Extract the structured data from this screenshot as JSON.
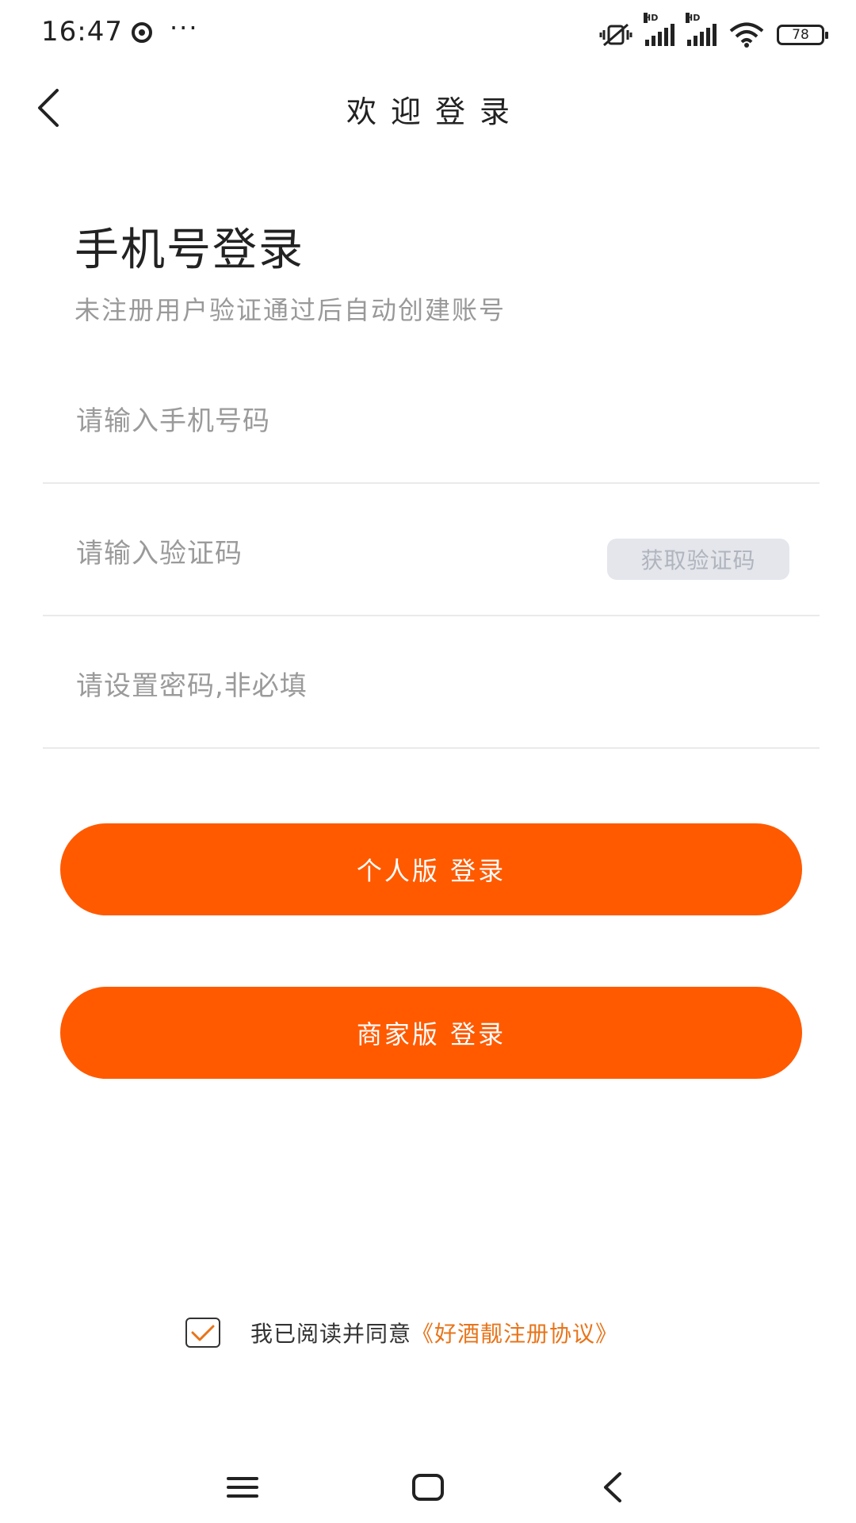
{
  "status_bar": {
    "time": "16:47",
    "more": "···",
    "signal_label_1": "HD",
    "signal_label_2": "HD",
    "battery": "78",
    "icons": [
      "vibrate-icon",
      "signal-icon",
      "signal-icon",
      "wifi-icon",
      "battery-icon"
    ]
  },
  "nav": {
    "title": "欢迎登录",
    "back_icon": "back-arrow-icon"
  },
  "header": {
    "title": "手机号登录",
    "subtitle": "未注册用户验证通过后自动创建账号"
  },
  "form": {
    "phone_placeholder": "请输入手机号码",
    "phone_value": "",
    "code_placeholder": "请输入验证码",
    "code_value": "",
    "get_code_label": "获取验证码",
    "password_placeholder": "请设置密码,非必填",
    "password_value": ""
  },
  "buttons": {
    "personal_login": "个人版 登录",
    "merchant_login": "商家版 登录"
  },
  "agreement": {
    "checked": true,
    "text": "我已阅读并同意",
    "link": "《好酒靓注册协议》"
  },
  "colors": {
    "accent": "#ff5a00",
    "link": "#e8741a",
    "placeholder": "#9a9a9a"
  },
  "system_nav": {
    "icons": [
      "menu-icon",
      "home-icon",
      "back-icon"
    ]
  }
}
